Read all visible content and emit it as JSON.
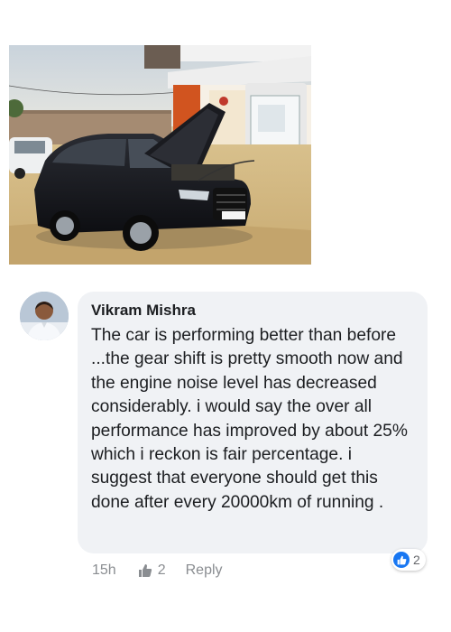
{
  "post": {
    "photo_icon": "car-photo"
  },
  "comment": {
    "author": "Vikram Mishra",
    "text": "The car is performing better than before ...the gear shift is pretty smooth now and the engine noise level has decreased considerably. i would say the over all performance has improved by about 25% which i reckon is fair percentage. i suggest that everyone should get this done after every 20000km of running .",
    "reaction_count": "2",
    "reaction_icon": "like-icon",
    "timestamp": "15h",
    "likes_count": "2",
    "reply_label": "Reply"
  },
  "colors": {
    "bubble": "#f0f2f5",
    "like_blue": "#1877f2",
    "meta_gray": "#8a8d91"
  }
}
